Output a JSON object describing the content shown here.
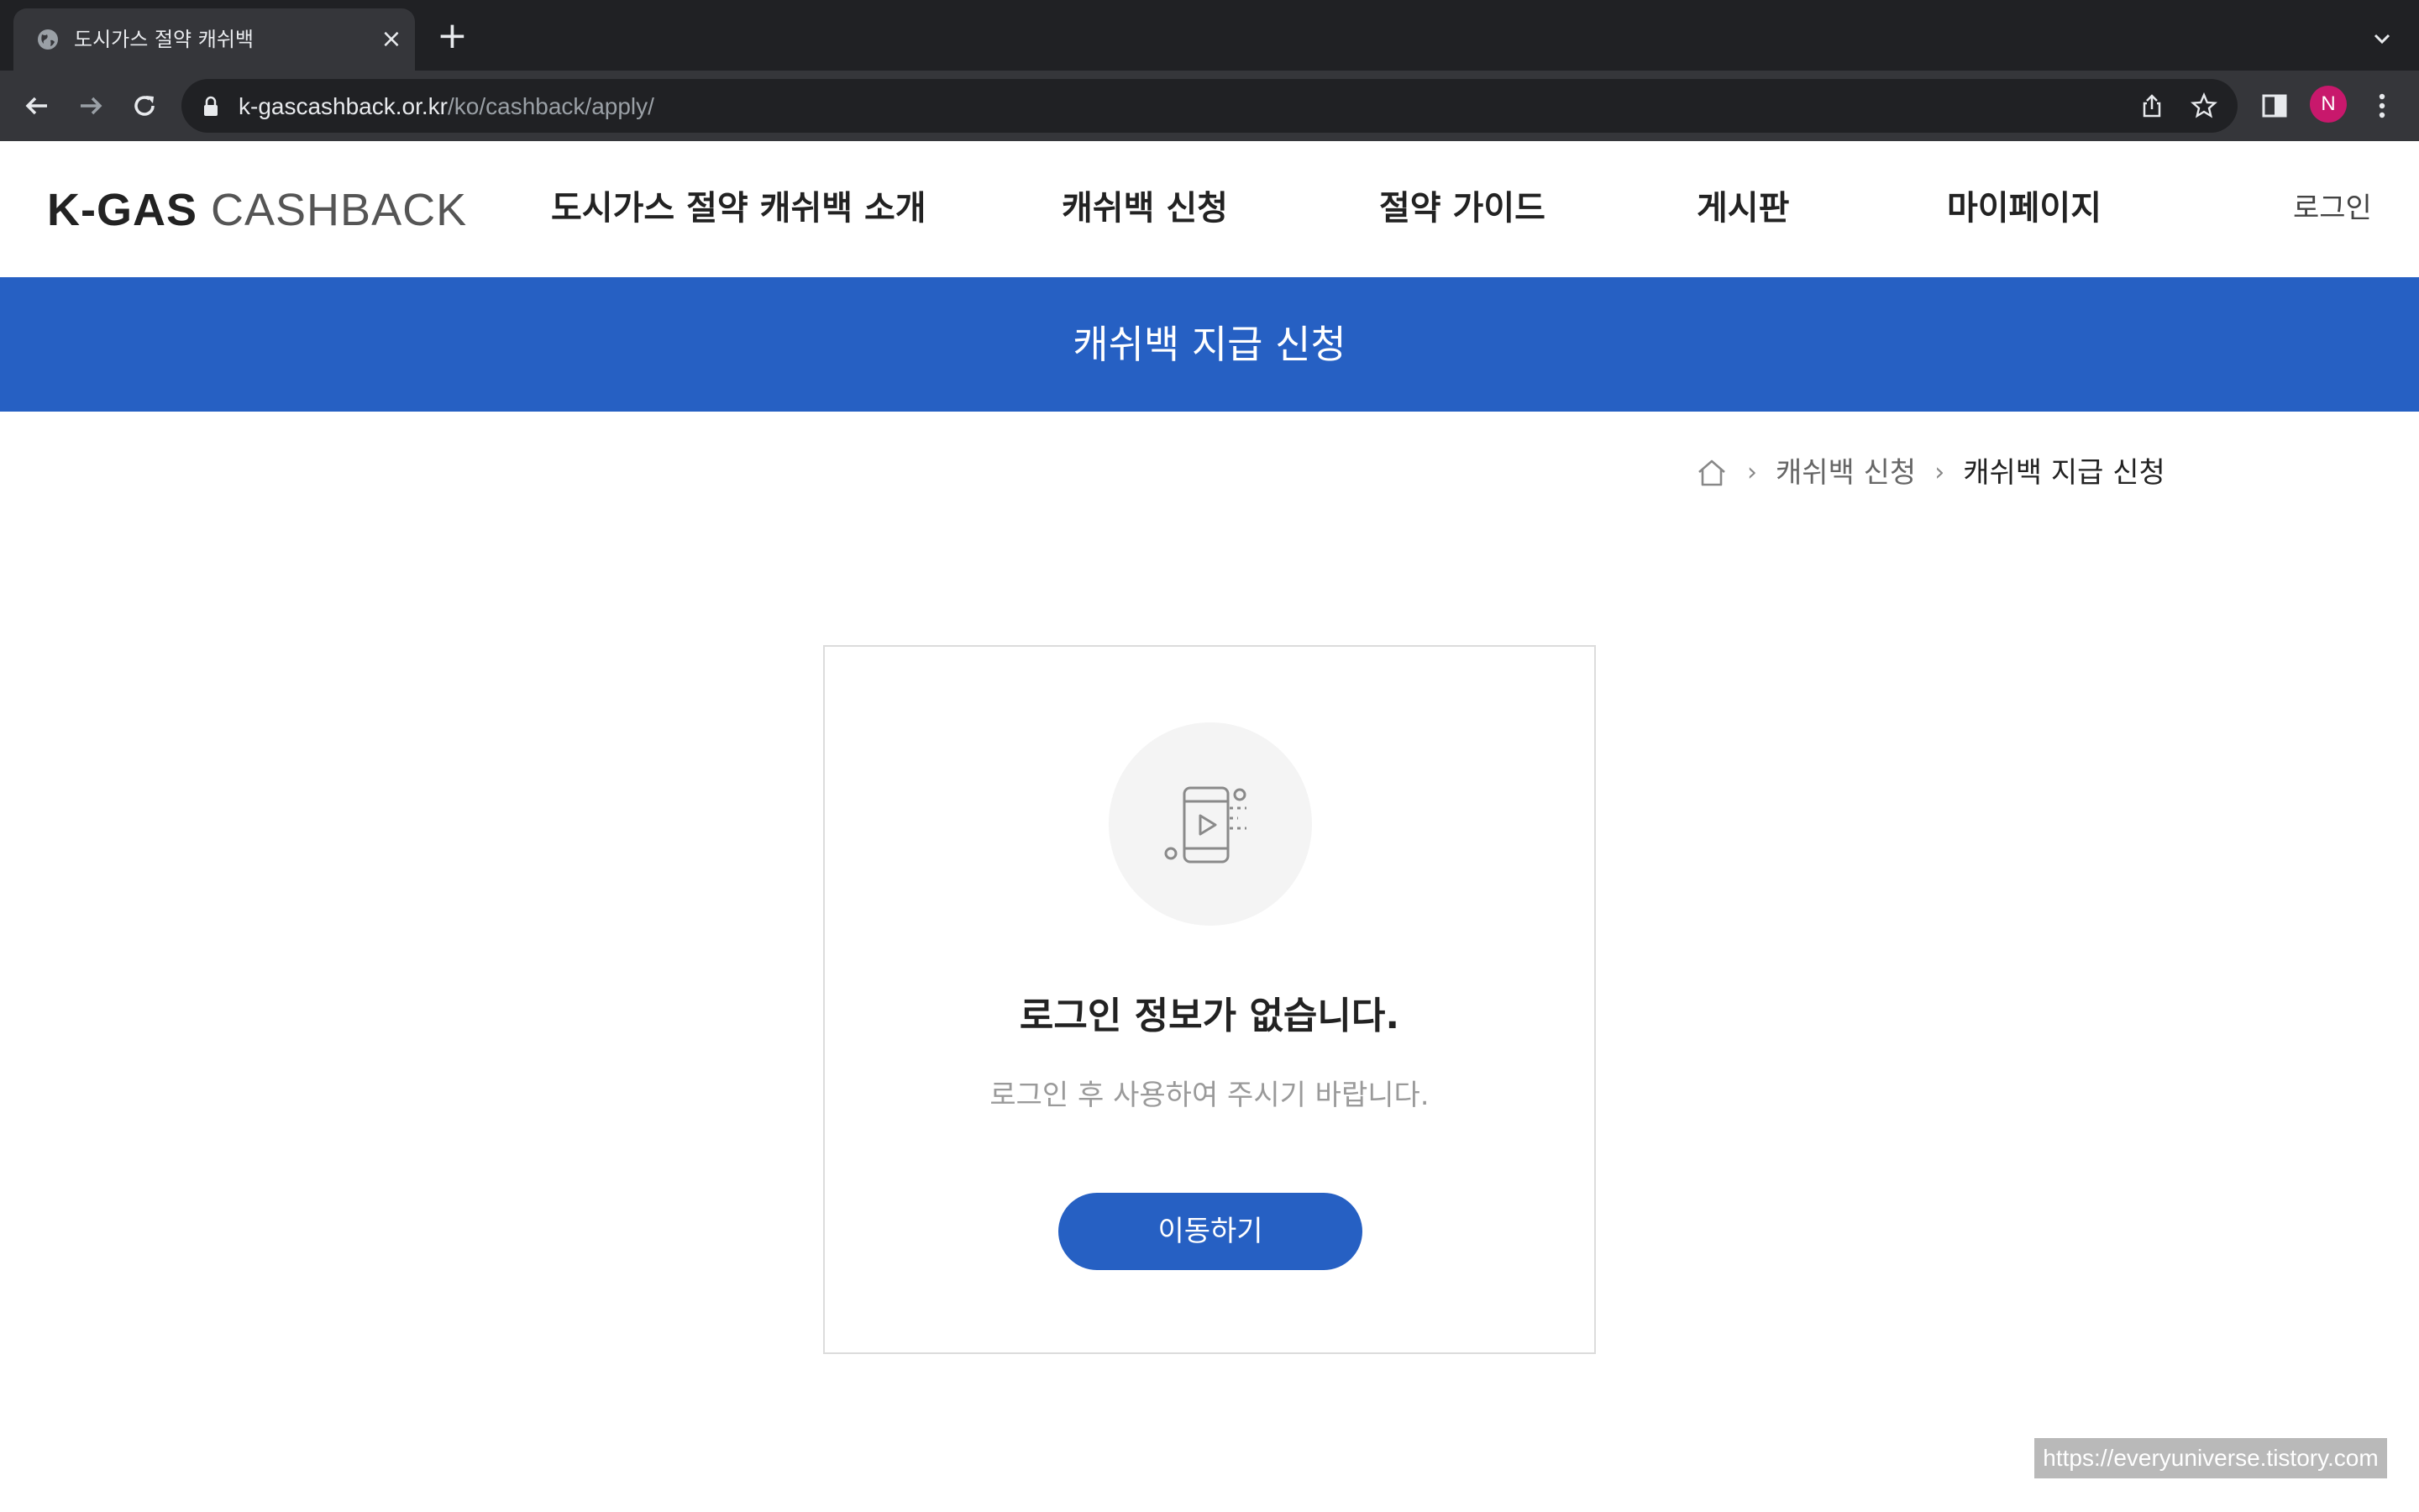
{
  "browser": {
    "tab_title": "도시가스 절약 캐쉬백",
    "url_host": "k-gascashback.or.kr",
    "url_path": "/ko/cashback/apply/",
    "profile_initial": "N",
    "profile_color": "#c8186c",
    "icons": [
      "globe-icon",
      "close-icon",
      "new-tab-icon",
      "tab-search-icon",
      "back-icon",
      "forward-icon",
      "reload-icon",
      "lock-icon",
      "share-icon",
      "bookmark-star-icon",
      "side-panel-icon",
      "menu-icon"
    ]
  },
  "header": {
    "logo_bold": "K-GAS",
    "logo_light": "CASHBACK",
    "nav": [
      {
        "label": "도시가스 절약 캐쉬백 소개"
      },
      {
        "label": "캐쉬백 신청"
      },
      {
        "label": "절약 가이드"
      },
      {
        "label": "게시판"
      },
      {
        "label": "마이페이지"
      }
    ],
    "login_label": "로그인"
  },
  "banner": {
    "title": "캐쉬백 지급 신청",
    "color": "#2660c3"
  },
  "breadcrumb": {
    "home_icon": "home-icon",
    "items": [
      "캐쉬백 신청",
      "캐쉬백 지급 신청"
    ]
  },
  "notice": {
    "icon": "mobile-play-icon",
    "title": "로그인 정보가 없습니다.",
    "description": "로그인 후 사용하여 주시기 바랍니다.",
    "button_label": "이동하기"
  },
  "watermark": "https://everyuniverse.tistory.com"
}
